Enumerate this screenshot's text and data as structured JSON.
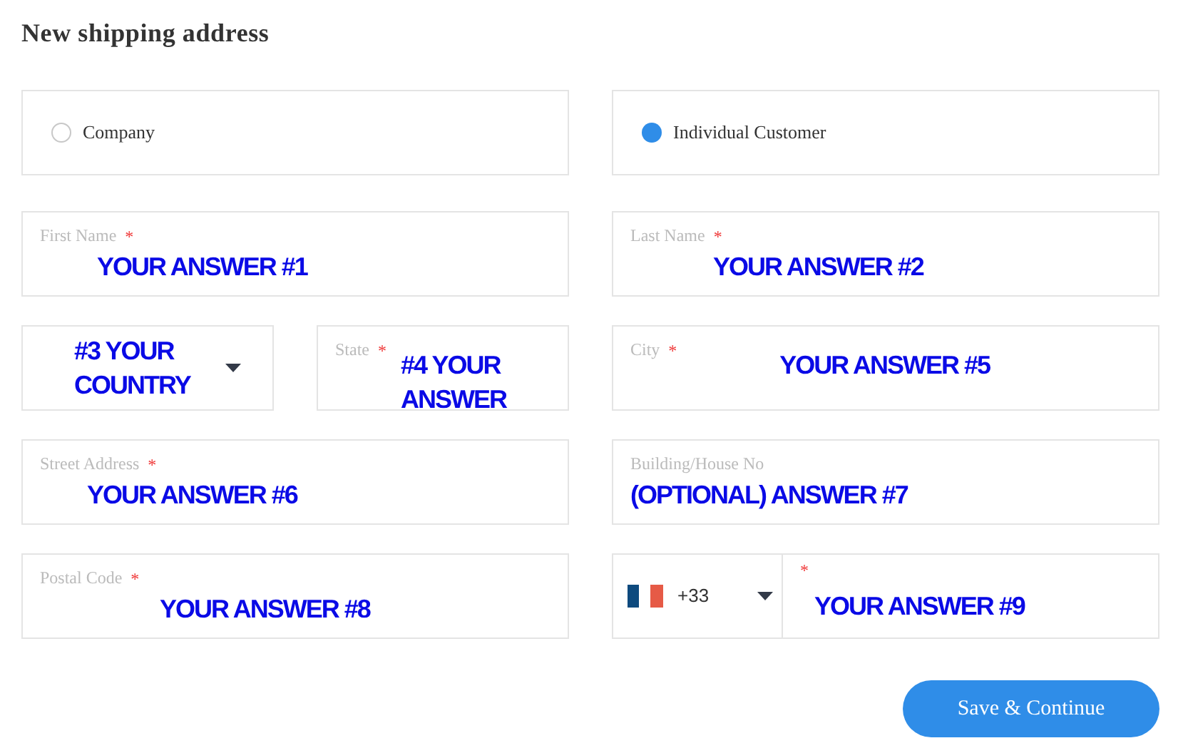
{
  "title": "New shipping address",
  "customer_types": [
    {
      "label": "Company",
      "selected": false
    },
    {
      "label": "Individual Customer",
      "selected": true
    }
  ],
  "fields": [
    {
      "kind": "text",
      "label": "First Name",
      "required_mark": "*",
      "value": "YOUR ANSWER #1"
    },
    {
      "kind": "text",
      "label": "Last Name",
      "required_mark": "*",
      "value": "YOUR ANSWER #2"
    },
    {
      "kind": "select",
      "value": "#3 YOUR COUNTRY"
    },
    {
      "kind": "inline",
      "label": "State",
      "required_mark": "*",
      "value": "#4 YOUR ANSWER"
    },
    {
      "kind": "inline",
      "label": "City",
      "required_mark": "*",
      "value": "YOUR ANSWER #5"
    },
    {
      "kind": "text",
      "label": "Street Address",
      "required_mark": "*",
      "value": "YOUR ANSWER #6"
    },
    {
      "kind": "text",
      "label": "Building/House No",
      "value": "(OPTIONAL) ANSWER #7"
    },
    {
      "kind": "text",
      "label": "Postal Code",
      "required_mark": "*",
      "value": "YOUR ANSWER #8"
    },
    {
      "kind": "phone",
      "code": "+33",
      "required_mark": "*",
      "value": "YOUR ANSWER #9"
    }
  ],
  "submit": "Save & Continue"
}
